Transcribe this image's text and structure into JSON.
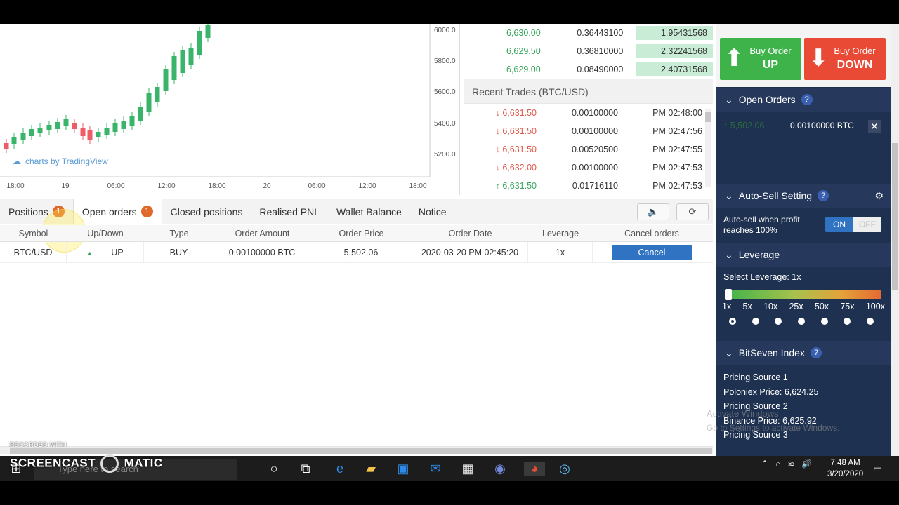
{
  "chart": {
    "price_ticks": [
      "6000.0",
      "5800.0",
      "5600.0",
      "5400.0",
      "5200.0"
    ],
    "time_ticks": [
      "18:00",
      "19",
      "06:00",
      "12:00",
      "18:00",
      "20",
      "06:00",
      "12:00",
      "18:00"
    ],
    "watermark": "charts by TradingView"
  },
  "book_top": [
    {
      "price": "6,630.00",
      "amount": "0.36443100",
      "total": "1.95431568"
    },
    {
      "price": "6,629.50",
      "amount": "0.36810000",
      "total": "2.32241568"
    },
    {
      "price": "6,629.00",
      "amount": "0.08490000",
      "total": "2.40731568"
    }
  ],
  "recent_trades": {
    "title": "Recent Trades (BTC/USD)",
    "rows": [
      {
        "dir": "down",
        "price": "6,631.50",
        "amount": "0.00100000",
        "time": "PM 02:48:00"
      },
      {
        "dir": "down",
        "price": "6,631.50",
        "amount": "0.00100000",
        "time": "PM 02:47:56"
      },
      {
        "dir": "down",
        "price": "6,631.50",
        "amount": "0.00520500",
        "time": "PM 02:47:55"
      },
      {
        "dir": "down",
        "price": "6,632.00",
        "amount": "0.00100000",
        "time": "PM 02:47:53"
      },
      {
        "dir": "up",
        "price": "6,631.50",
        "amount": "0.01716110",
        "time": "PM 02:47:53"
      }
    ]
  },
  "tabs": [
    {
      "label": "Positions",
      "badge": "1"
    },
    {
      "label": "Open orders",
      "badge": "1"
    },
    {
      "label": "Closed positions"
    },
    {
      "label": "Realised PNL"
    },
    {
      "label": "Wallet Balance"
    },
    {
      "label": "Notice"
    }
  ],
  "table": {
    "headers": [
      "Symbol",
      "Up/Down",
      "Type",
      "Order Amount",
      "Order Price",
      "Order Date",
      "Leverage",
      "Cancel orders"
    ],
    "row": {
      "symbol": "BTC/USD",
      "updown": "UP",
      "type": "BUY",
      "amount": "0.00100000 BTC",
      "price": "5,502.06",
      "date": "2020-03-20 PM 02:45:20",
      "leverage": "1x",
      "cancel": "Cancel"
    }
  },
  "side": {
    "buy_up": {
      "l1": "Buy Order",
      "l2": "UP"
    },
    "buy_down": {
      "l1": "Buy Order",
      "l2": "DOWN"
    },
    "open_orders": {
      "title": "Open Orders",
      "q": "?",
      "price": "5,502.06",
      "amount": "0.00100000 BTC"
    },
    "auto_sell": {
      "title": "Auto-Sell Setting",
      "q": "?",
      "text1": "Auto-sell when profit",
      "text2": "reaches 100%",
      "on": "ON",
      "off": "OFF"
    },
    "leverage": {
      "title": "Leverage",
      "select": "Select Leverage: 1x",
      "labels": [
        "1x",
        "5x",
        "10x",
        "25x",
        "50x",
        "75x",
        "100x"
      ],
      "selected_index": 0
    },
    "index": {
      "title": "BitSeven Index",
      "q": "?",
      "lines": [
        "Pricing Source 1",
        "Poloniex Price: 6,624.25",
        "Pricing Source 2",
        "Binance Price: 6,625.92",
        "Pricing Source 3"
      ]
    }
  },
  "watermark": {
    "l1": "Activate Windows",
    "l2": "Go to Settings to activate Windows."
  },
  "recorder": {
    "l1": "RECORDED WITH",
    "l2": "SCREENCAST",
    "l3": "MATIC"
  },
  "taskbar": {
    "search": "Type here to search",
    "time": "7:48 AM",
    "date": "3/20/2020"
  }
}
